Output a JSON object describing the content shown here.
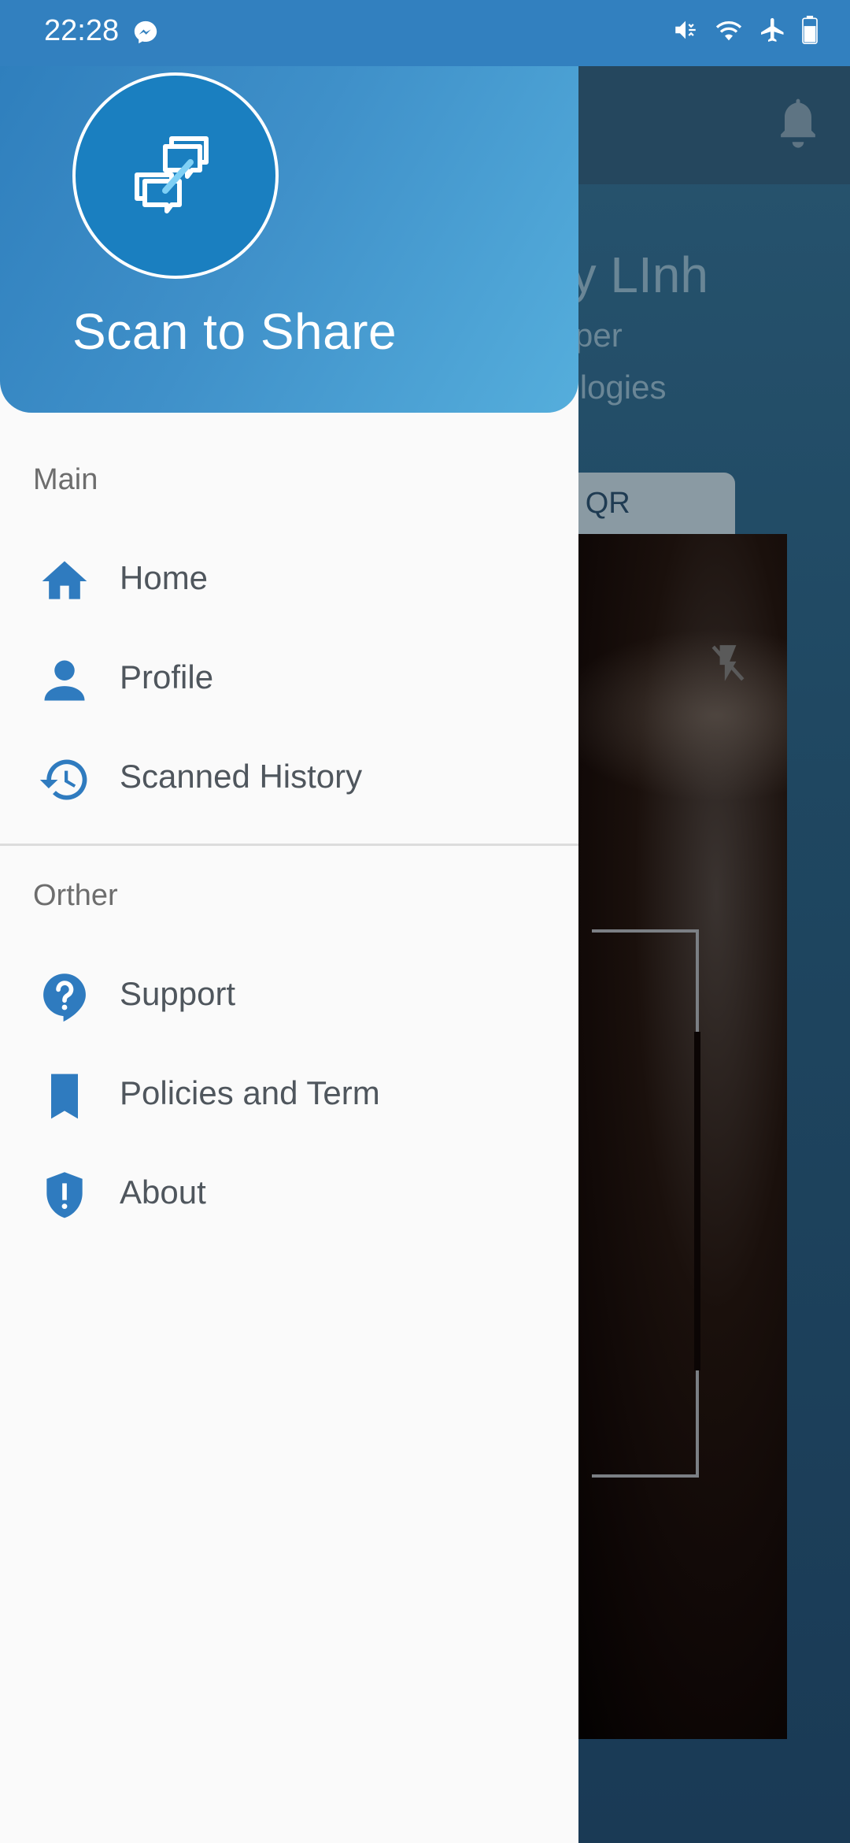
{
  "status_bar": {
    "time": "22:28",
    "icons": [
      "messenger-icon",
      "mute-vibrate-icon",
      "wifi-icon",
      "airplane-icon",
      "battery-icon"
    ]
  },
  "background_app": {
    "user_name_fragment": "uy LInh",
    "role_fragment": "per",
    "company_fragment": "nologies",
    "tab_fragment": "n QR",
    "icons": [
      "bell-icon",
      "flash-off-icon"
    ]
  },
  "drawer": {
    "app_title": "Scan to Share",
    "logo_icon": "chat-share-icon",
    "sections": [
      {
        "label": "Main",
        "items": [
          {
            "label": "Home",
            "icon": "home-icon"
          },
          {
            "label": "Profile",
            "icon": "person-icon"
          },
          {
            "label": "Scanned History",
            "icon": "history-icon"
          }
        ]
      },
      {
        "label": "Orther",
        "items": [
          {
            "label": "Support",
            "icon": "help-icon"
          },
          {
            "label": "Policies and Term",
            "icon": "bookmark-icon"
          },
          {
            "label": "About",
            "icon": "shield-alert-icon"
          }
        ]
      }
    ]
  },
  "colors": {
    "status_bar": "#3280bf",
    "accent": "#2f7fbd",
    "icon": "#2f7bbf",
    "menu_text": "#4f565d",
    "section_text": "#6d6d6d",
    "drawer_bg": "#fafafa"
  }
}
